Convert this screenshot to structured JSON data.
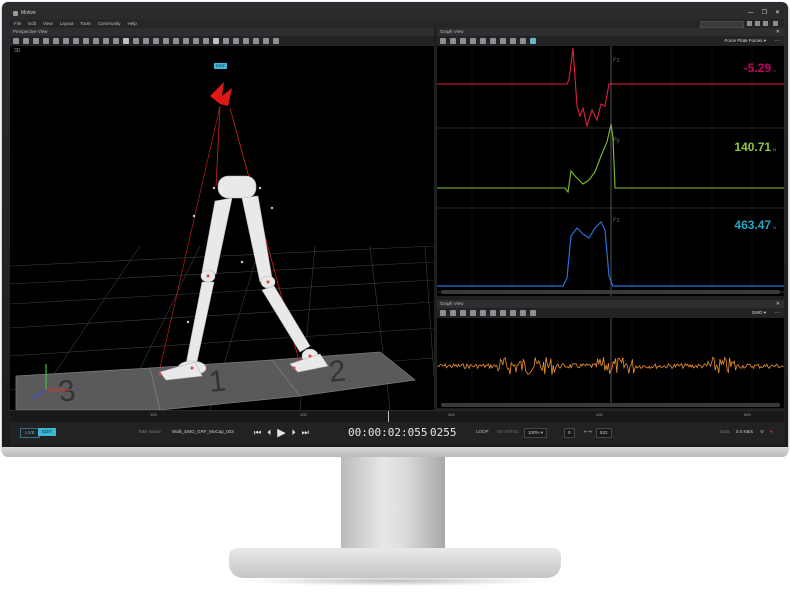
{
  "app": {
    "title": "Motive",
    "menu": [
      "File",
      "Edit",
      "View",
      "Layout",
      "Tools",
      "Community",
      "Help"
    ],
    "window_controls": [
      "—",
      "❐",
      "✕"
    ]
  },
  "perspective": {
    "header": "Perspective View",
    "view_mode": "3D",
    "edit_badge": "EDIT",
    "plates": [
      "3",
      "1",
      "2"
    ]
  },
  "graph_top": {
    "header": "Graph View",
    "dropdown": "Force Plate Forces",
    "channels": [
      {
        "label": "Fz",
        "value": "-5.29",
        "unit": "N",
        "color": "#c4006a"
      },
      {
        "label": "Fy",
        "value": "140.71",
        "unit": "N",
        "color": "#8dc63f"
      },
      {
        "label": "Fz",
        "value": "463.47",
        "unit": "N",
        "color": "#1fa6c2"
      }
    ]
  },
  "graph_bottom": {
    "header": "Graph View",
    "dropdown": "EMG"
  },
  "timeline": {
    "ticks": [
      "100",
      "200",
      "300",
      "400",
      "500"
    ]
  },
  "bottombar": {
    "live": "LIVE",
    "edit": "EDIT",
    "take_label": "Take Name",
    "take_name": "Walk_EMG_GRF_MoCap_003",
    "timecode": "00:00:02:055",
    "frame": "0255",
    "loop": "LOOP",
    "reverse": "REVERSE",
    "speed": "100%",
    "in_frame": "0",
    "out_frame": "522",
    "data_label": "Data",
    "data_rate": "0.0 KB/s"
  },
  "colors": {
    "accent": "#39b8d6",
    "force_red": "#e0203a",
    "force_green": "#7fbf2a",
    "force_blue": "#2a6fd8",
    "emg_orange": "#f0922b"
  }
}
